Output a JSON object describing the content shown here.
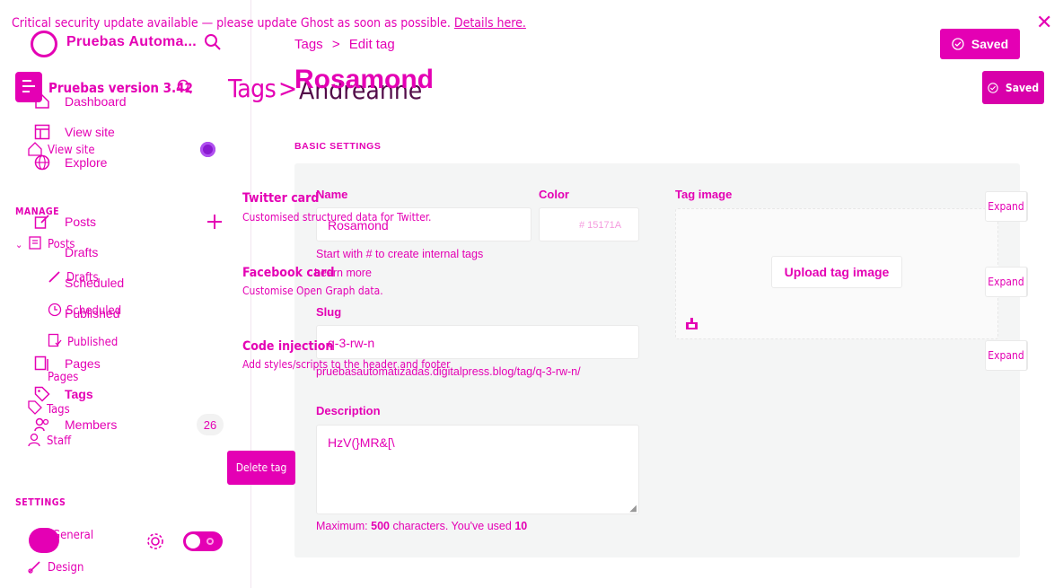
{
  "banner": {
    "message": "Critical security update available — please update Ghost as soon as possible.",
    "link": "Details here."
  },
  "sidebar": {
    "site_name": "Pruebas Automa...",
    "brand_name": "Pruebas version 3.42",
    "nav_a": {
      "dashboard": "Dashboard",
      "view_site": "View site",
      "explore": "Explore",
      "posts": "Posts",
      "drafts": "Drafts",
      "scheduled": "Scheduled",
      "published": "Published",
      "pages": "Pages",
      "tags": "Tags",
      "members": "Members",
      "members_count": "26"
    },
    "nav_b": {
      "view_site": "View site",
      "manage_header": "MANAGE",
      "posts": "Posts",
      "drafts": "Drafts",
      "scheduled": "Scheduled",
      "published": "Published",
      "pages": "Pages",
      "tags": "Tags",
      "staff": "Staff",
      "settings_header": "SETTINGS",
      "general": "General",
      "design": "Design"
    }
  },
  "header": {
    "breadcrumb_tags": "Tags",
    "breadcrumb_sep": ">",
    "breadcrumb_edit": "Edit tag",
    "title_section": "Tags",
    "title_sep": ">",
    "title_old": "Andreanne",
    "title_new": "Rosamond",
    "saved_top": "Saved",
    "saved_main": "Saved"
  },
  "form": {
    "section_label": "BASIC SETTINGS",
    "name_label": "Name",
    "name_value": "Rosamond",
    "name_hint": "Start with # to create internal tags",
    "learn_more": "Learn more",
    "color_label": "Color",
    "color_value": "# 15171A",
    "slug_label": "Slug",
    "slug_value": "q-3-rw-n",
    "slug_url": "pruebasautomatizadas.digitalpress.blog/tag/q-3-rw-n/",
    "description_label": "Description",
    "description_value": "HzV(}MR&[\\",
    "char_prefix": "Maximum:",
    "char_max": "500",
    "char_mid": "characters. You've used",
    "char_used": "10",
    "image_label": "Tag image",
    "upload_label": "Upload tag image"
  },
  "cards": [
    {
      "title": "Twitter card",
      "desc": "Customised structured data for Twitter.",
      "button": "Expand"
    },
    {
      "title": "Facebook card",
      "desc": "Customise Open Graph data.",
      "button": "Expand"
    },
    {
      "title": "Code injection",
      "desc": "Add styles/scripts to the header and footer",
      "button": "Expand"
    }
  ],
  "actions": {
    "delete": "Delete tag"
  },
  "colors": {
    "accent": "#e400b4",
    "panel": "#f4f5f5",
    "badge": "#8a1ad0"
  }
}
